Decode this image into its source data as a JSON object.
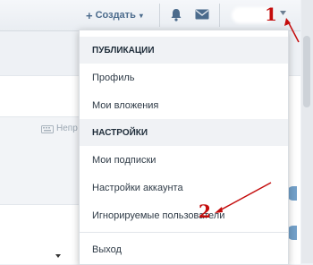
{
  "header": {
    "create_label": "Создать",
    "plus_glyph": "+",
    "caret_glyph": "▾",
    "accent_color": "#4b6b8c"
  },
  "menu": {
    "sections": [
      {
        "title": "ПУБЛИКАЦИИ",
        "items": [
          "Профиль",
          "Мои вложения"
        ]
      },
      {
        "title": "НАСТРОЙКИ",
        "items": [
          "Мои подписки",
          "Настройки аккаунта",
          "Игнорируемые пользователи"
        ]
      }
    ],
    "logout": "Выход"
  },
  "background": {
    "partial_text": "Непр"
  },
  "annotations": {
    "marker_1": "1",
    "marker_2": "2",
    "color": "#c40c0c"
  }
}
